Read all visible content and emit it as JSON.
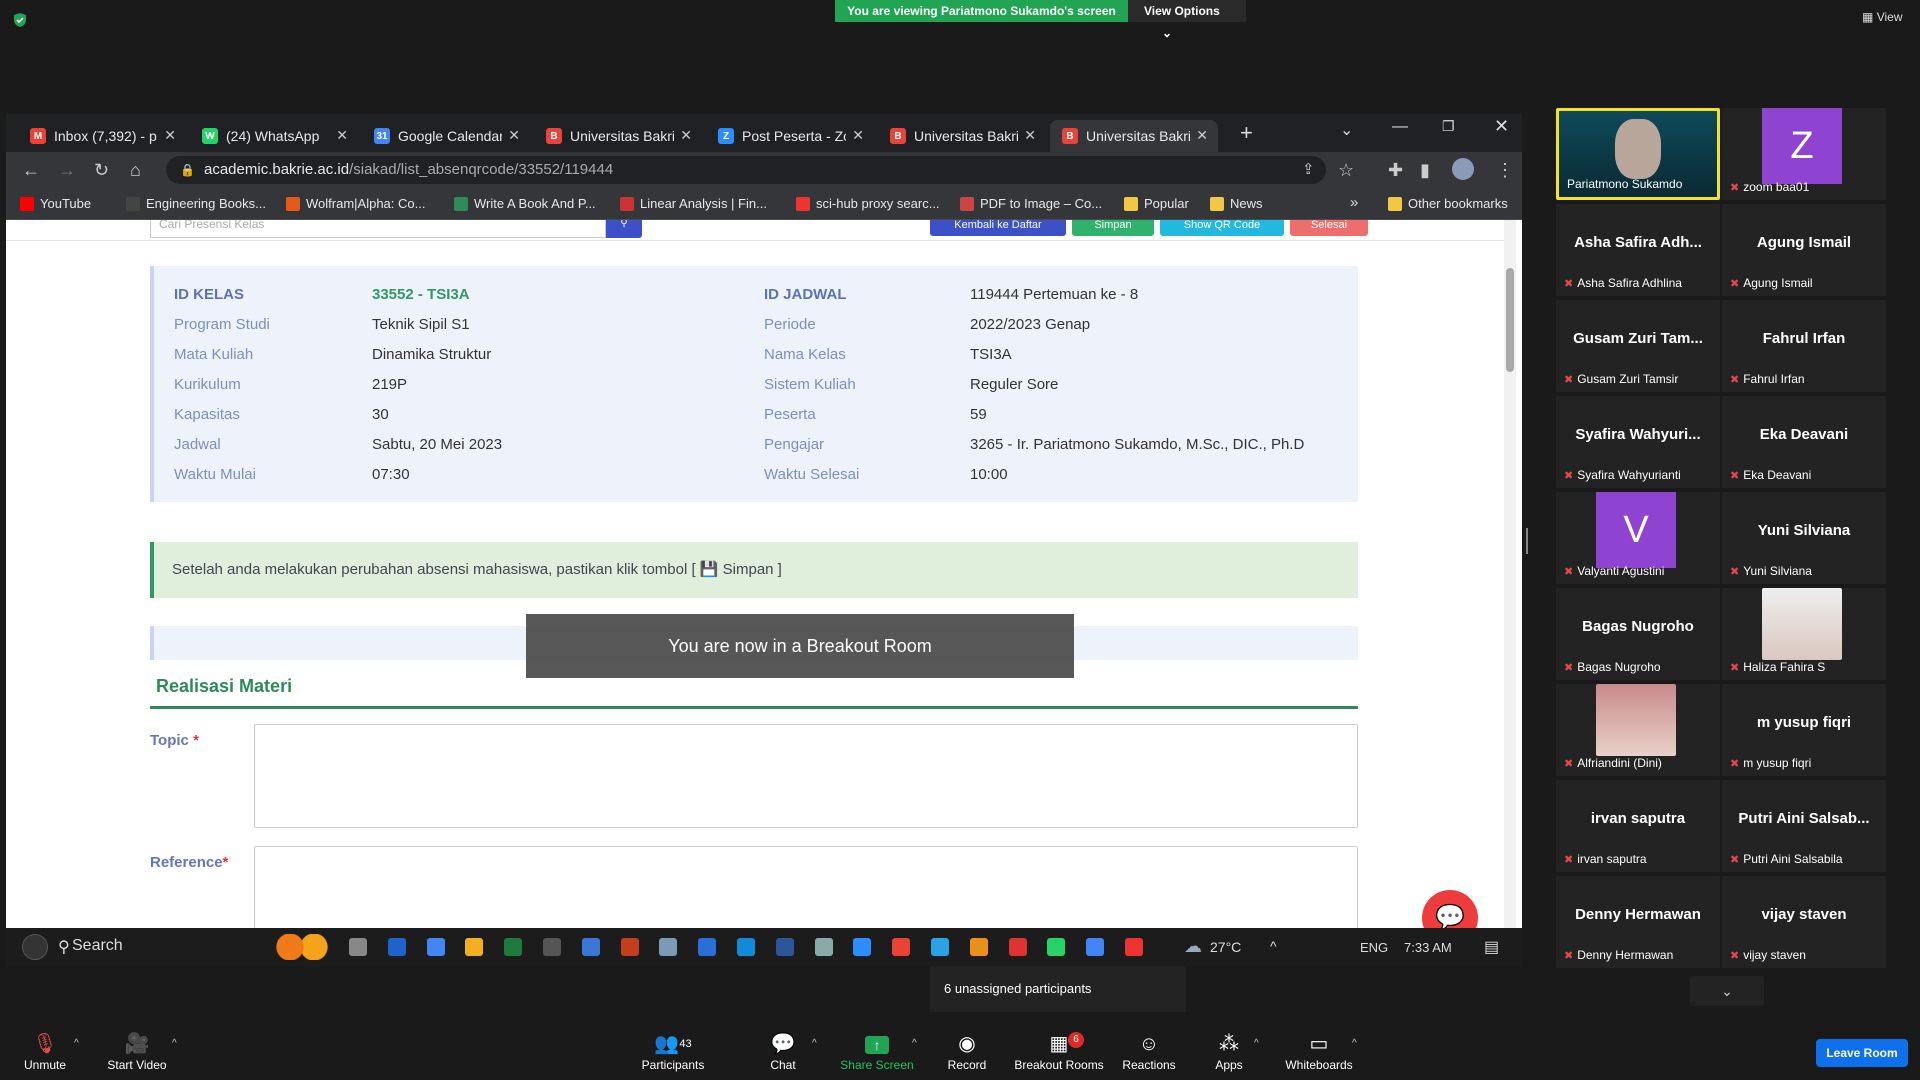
{
  "zoom": {
    "viewing_banner": "You are viewing Pariatmono Sukamdo's screen",
    "view_options": "View Options",
    "view_top_right": "View",
    "breakout_notice": "You are now in a Breakout Room",
    "unassigned": "6 unassigned participants",
    "participants_count": "43",
    "breakout_badge": "6",
    "leave": "Leave Room",
    "toolbar": {
      "unmute": "Unmute",
      "start_video": "Start Video",
      "participants": "Participants",
      "chat": "Chat",
      "share_screen": "Share Screen",
      "record": "Record",
      "breakout_rooms": "Breakout Rooms",
      "reactions": "Reactions",
      "apps": "Apps",
      "whiteboards": "Whiteboards"
    },
    "gallery": [
      {
        "name": "",
        "label": "Pariatmono Sukamdo",
        "muted": false
      },
      {
        "name": "Z",
        "label": "zoom baa01",
        "muted": true
      },
      {
        "name": "Asha Safira Adh...",
        "label": "Asha Safira Adhlina",
        "muted": true
      },
      {
        "name": "Agung Ismail",
        "label": "Agung Ismail",
        "muted": true
      },
      {
        "name": "Gusam Zuri Tam...",
        "label": "Gusam Zuri Tamsir",
        "muted": true
      },
      {
        "name": "Fahrul Irfan",
        "label": "Fahrul Irfan",
        "muted": true
      },
      {
        "name": "Syafira  Wahyuri...",
        "label": "Syafira Wahyurianti",
        "muted": true
      },
      {
        "name": "Eka Deavani",
        "label": "Eka Deavani",
        "muted": true
      },
      {
        "name": "V",
        "label": "Valyanti Agustini",
        "muted": true
      },
      {
        "name": "Yuni Silviana",
        "label": "Yuni Silviana",
        "muted": true
      },
      {
        "name": "Bagas Nugroho",
        "label": "Bagas Nugroho",
        "muted": true
      },
      {
        "name": "",
        "label": "Haliza Fahira S",
        "muted": true
      },
      {
        "name": "",
        "label": "Alfriandini (Dini)",
        "muted": true
      },
      {
        "name": "m yusup fiqri",
        "label": "m yusup fiqri",
        "muted": true
      },
      {
        "name": "irvan saputra",
        "label": "irvan saputra",
        "muted": true
      },
      {
        "name": "Putri Aini Salsab...",
        "label": "Putri Aini Salsabila",
        "muted": true
      },
      {
        "name": "Denny Hermawan",
        "label": "Denny Hermawan",
        "muted": true
      },
      {
        "name": "vijay staven",
        "label": "vijay staven",
        "muted": true
      }
    ]
  },
  "browser": {
    "tabs": [
      {
        "title": "Inbox (7,392) - p",
        "icon": "gmail-icon",
        "color": "#ea4335",
        "letter": "M"
      },
      {
        "title": "(24) WhatsApp",
        "icon": "whatsapp-icon",
        "color": "#25d366",
        "letter": "W"
      },
      {
        "title": "Google Calendar",
        "icon": "calendar-icon",
        "color": "#4285f4",
        "letter": "31"
      },
      {
        "title": "Universitas Bakrie",
        "icon": "bakrie-icon",
        "color": "#e8443a",
        "letter": "B"
      },
      {
        "title": "Post Peserta - Zo",
        "icon": "zoom-icon",
        "color": "#2d8cff",
        "letter": "Z"
      },
      {
        "title": "Universitas Bakrie",
        "icon": "bakrie-icon",
        "color": "#e8443a",
        "letter": "B"
      },
      {
        "title": "Universitas Bakrie",
        "icon": "bakrie-icon",
        "color": "#e8443a",
        "letter": "B"
      }
    ],
    "url_host": "academic.bakrie.ac.id",
    "url_path": "/siakad/list_absenqrcode/33552/119444",
    "bookmarks": [
      "YouTube",
      "Engineering Books...",
      "Wolfram|Alpha: Co...",
      "Write A Book And P...",
      "Linear Analysis | Fin...",
      "sci-hub proxy searc...",
      "PDF to Image – Co...",
      "Popular",
      "News",
      "Other bookmarks"
    ]
  },
  "page": {
    "search_placeholder": "Cari Presensi Kelas",
    "buttons": [
      "Kembali ke Daftar",
      "Simpan",
      "Show QR Code",
      "Selesai"
    ],
    "left": [
      {
        "label": "ID KELAS",
        "value": "33552 - TSI3A"
      },
      {
        "label": "Program Studi",
        "value": "Teknik Sipil S1"
      },
      {
        "label": "Mata Kuliah",
        "value": "Dinamika Struktur"
      },
      {
        "label": "Kurikulum",
        "value": "219P"
      },
      {
        "label": "Kapasitas",
        "value": "30"
      },
      {
        "label": "Jadwal",
        "value": "Sabtu, 20 Mei 2023"
      },
      {
        "label": "Waktu Mulai",
        "value": "07:30"
      }
    ],
    "right": [
      {
        "label": "ID JADWAL",
        "value": "119444 Pertemuan ke - 8"
      },
      {
        "label": "Periode",
        "value": "2022/2023 Genap"
      },
      {
        "label": "Nama Kelas",
        "value": "TSI3A"
      },
      {
        "label": "Sistem Kuliah",
        "value": "Reguler Sore"
      },
      {
        "label": "Peserta",
        "value": "59"
      },
      {
        "label": "Pengajar",
        "value": "3265 - Ir. Pariatmono Sukamdo, M.Sc., DIC., Ph.D"
      },
      {
        "label": "Waktu Selesai",
        "value": "10:00"
      }
    ],
    "alert": "Setelah anda melakukan perubahan absensi mahasiswa, pastikan klik tombol [ 💾 Simpan ]",
    "section_title": "Realisasi Materi",
    "topic_label": "Topic",
    "reference_label": "Reference",
    "required_mark": "*"
  },
  "taskbar": {
    "search": "Search",
    "weather": "27°C",
    "lang": "ENG",
    "time": "7:33 AM"
  }
}
